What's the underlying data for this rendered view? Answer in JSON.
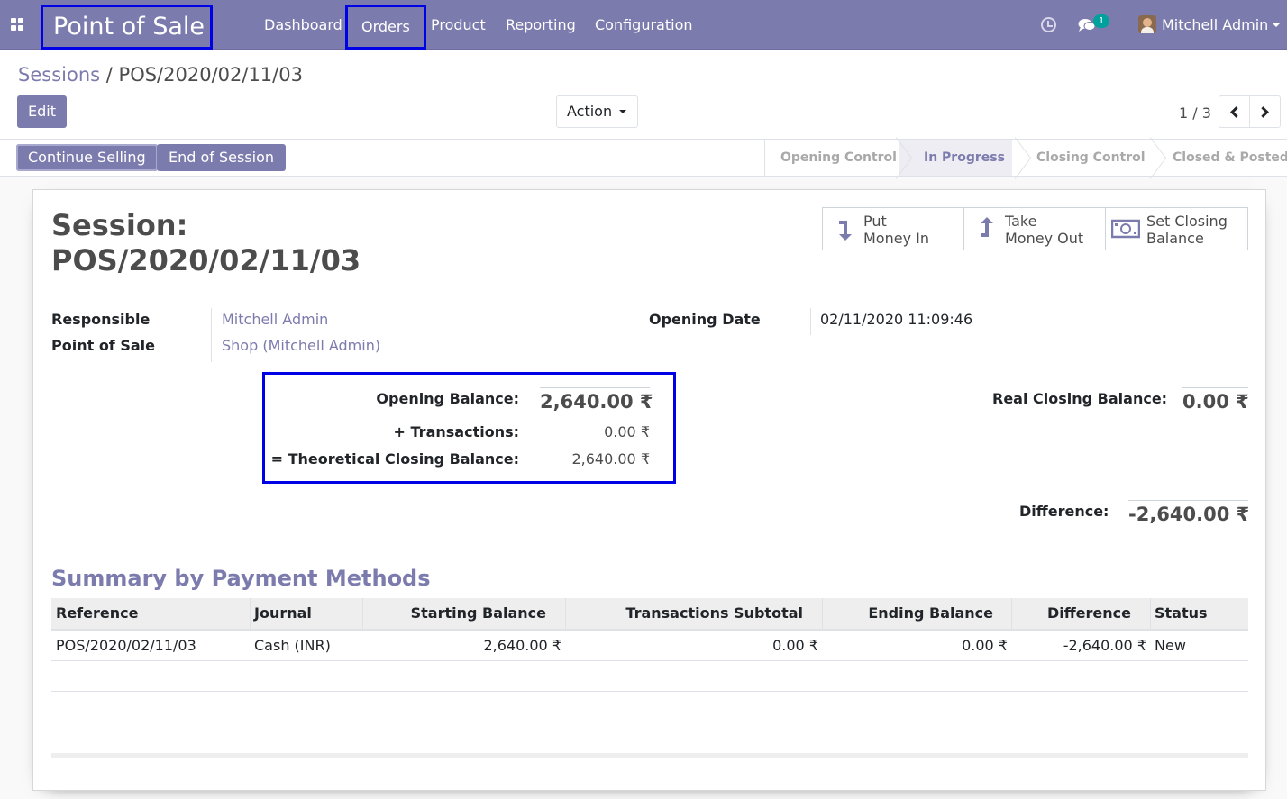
{
  "navbar": {
    "app_title": "Point of Sale",
    "menu": [
      {
        "label": "Dashboard"
      },
      {
        "label": "Orders"
      },
      {
        "label": "Product"
      },
      {
        "label": "Reporting"
      },
      {
        "label": "Configuration"
      }
    ],
    "chat_badge": "1",
    "user_name": "Mitchell Admin",
    "highlight_color": "#0000e6",
    "bar_color": "#7c7bad"
  },
  "control_panel": {
    "breadcrumb_parent": "Sessions",
    "breadcrumb_separator": "/",
    "breadcrumb_current": "POS/2020/02/11/03",
    "edit_label": "Edit",
    "action_label": "Action",
    "pager": "1 / 3"
  },
  "statusbar": {
    "buttons": [
      {
        "label": "Continue Selling"
      },
      {
        "label": "End of Session"
      }
    ],
    "stages": [
      {
        "label": "Opening Control"
      },
      {
        "label": "In Progress",
        "current": true
      },
      {
        "label": "Closing Control"
      },
      {
        "label": "Closed & Posted"
      }
    ]
  },
  "sheet": {
    "title_line1": "Session:",
    "title_line2": "POS/2020/02/11/03",
    "smart_buttons": [
      {
        "line1": "Put",
        "line2": "Money In",
        "icon": "arrow-down-icon"
      },
      {
        "line1": "Take",
        "line2": "Money Out",
        "icon": "arrow-up-icon"
      },
      {
        "line1": "Set Closing",
        "line2": "Balance",
        "icon": "money-icon"
      }
    ],
    "fields": {
      "responsible_label": "Responsible",
      "responsible_value": "Mitchell Admin",
      "pos_label": "Point of Sale",
      "pos_value": "Shop (Mitchell Admin)",
      "opening_date_label": "Opening Date",
      "opening_date_value": "02/11/2020 11:09:46"
    },
    "balances": {
      "opening_label": "Opening Balance:",
      "opening_value": "2,640.00 ₹",
      "transactions_label": "+ Transactions:",
      "transactions_value": "0.00 ₹",
      "theoretical_label": "= Theoretical Closing Balance:",
      "theoretical_value": "2,640.00 ₹",
      "real_closing_label": "Real Closing Balance:",
      "real_closing_value": "0.00 ₹",
      "difference_label": "Difference:",
      "difference_value": "-2,640.00 ₹"
    },
    "summary_title": "Summary by Payment Methods",
    "table": {
      "columns": [
        "Reference",
        "Journal",
        "Starting Balance",
        "Transactions Subtotal",
        "Ending Balance",
        "Difference",
        "Status"
      ],
      "rows": [
        [
          "POS/2020/02/11/03",
          "Cash (INR)",
          "2,640.00 ₹",
          "0.00 ₹",
          "0.00 ₹",
          "-2,640.00 ₹",
          "New"
        ]
      ]
    }
  }
}
